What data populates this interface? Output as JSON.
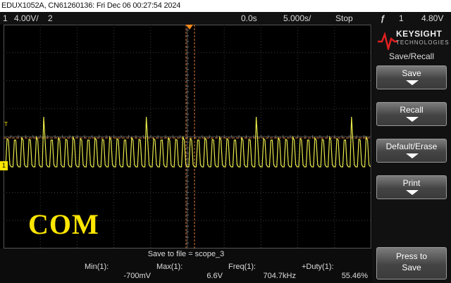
{
  "header": {
    "title": "EDUX1052A, CN61260136: Fri Dec 06 00:27:54 2024"
  },
  "status_bar": {
    "ch1_num": "1",
    "ch1_scale": "4.00V/",
    "ch2_num": "2",
    "time_delay": "0.0s",
    "time_scale": "5.000s/",
    "run_state": "Stop",
    "trigger_symbol": "ƒ",
    "trigger_ch": "1",
    "trigger_level": "4.80V"
  },
  "right_panel": {
    "brand": "KEYSIGHT",
    "brand_sub": "TECHNOLOGIES",
    "menu_title": "Save/Recall",
    "buttons": [
      {
        "label": "Save"
      },
      {
        "label": "Recall"
      },
      {
        "label": "Default/Erase"
      },
      {
        "label": "Print"
      }
    ],
    "press_to_save_line1": "Press to",
    "press_to_save_line2": "Save"
  },
  "bottom": {
    "save_to_file": "Save to file = scope_3",
    "measurements": [
      {
        "label": "Min(1):",
        "value": "-700mV"
      },
      {
        "label": "Max(1):",
        "value": "6.6V"
      },
      {
        "label": "Freq(1):",
        "value": "704.7kHz"
      },
      {
        "label": "+Duty(1):",
        "value": "55.46%"
      }
    ]
  },
  "overlay": {
    "label": "COM"
  },
  "markers": {
    "trigger": "T",
    "ground": "1"
  },
  "colors": {
    "trace": "#e9e94a",
    "trigger_line": "#e07b3a",
    "accent": "#ff8c1a",
    "overlay_text": "#ffe600"
  }
}
